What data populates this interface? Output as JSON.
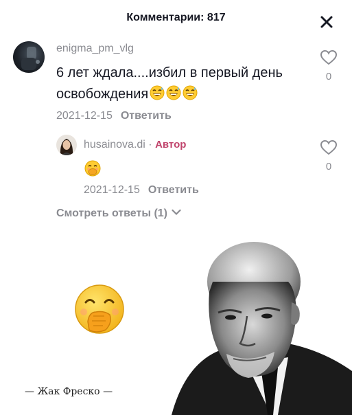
{
  "header": {
    "title": "Комментарии: 817",
    "close_icon": "close-icon"
  },
  "comments": [
    {
      "username": "enigma_pm_vlg",
      "text": "6 лет ждала....избил в первый день освобождения",
      "emoji": "grinning-sweat-emoji",
      "date": "2021-12-15",
      "reply_label": "Ответить",
      "likes": "0"
    }
  ],
  "reply": {
    "username": "husainova.di",
    "separator": "·",
    "author_badge": "Автор",
    "emoji": "face-with-hand-over-mouth-emoji",
    "date": "2021-12-15",
    "reply_label": "Ответить",
    "likes": "0"
  },
  "view_replies": "Смотреть ответы (1)",
  "meme": {
    "caption": "— Жак Фреско —",
    "emoji": "face-with-hand-over-mouth-emoji",
    "portrait": "elderly-man-portrait"
  },
  "colors": {
    "text": "#161823",
    "muted": "#8a8b91",
    "author": "#c0446c"
  }
}
